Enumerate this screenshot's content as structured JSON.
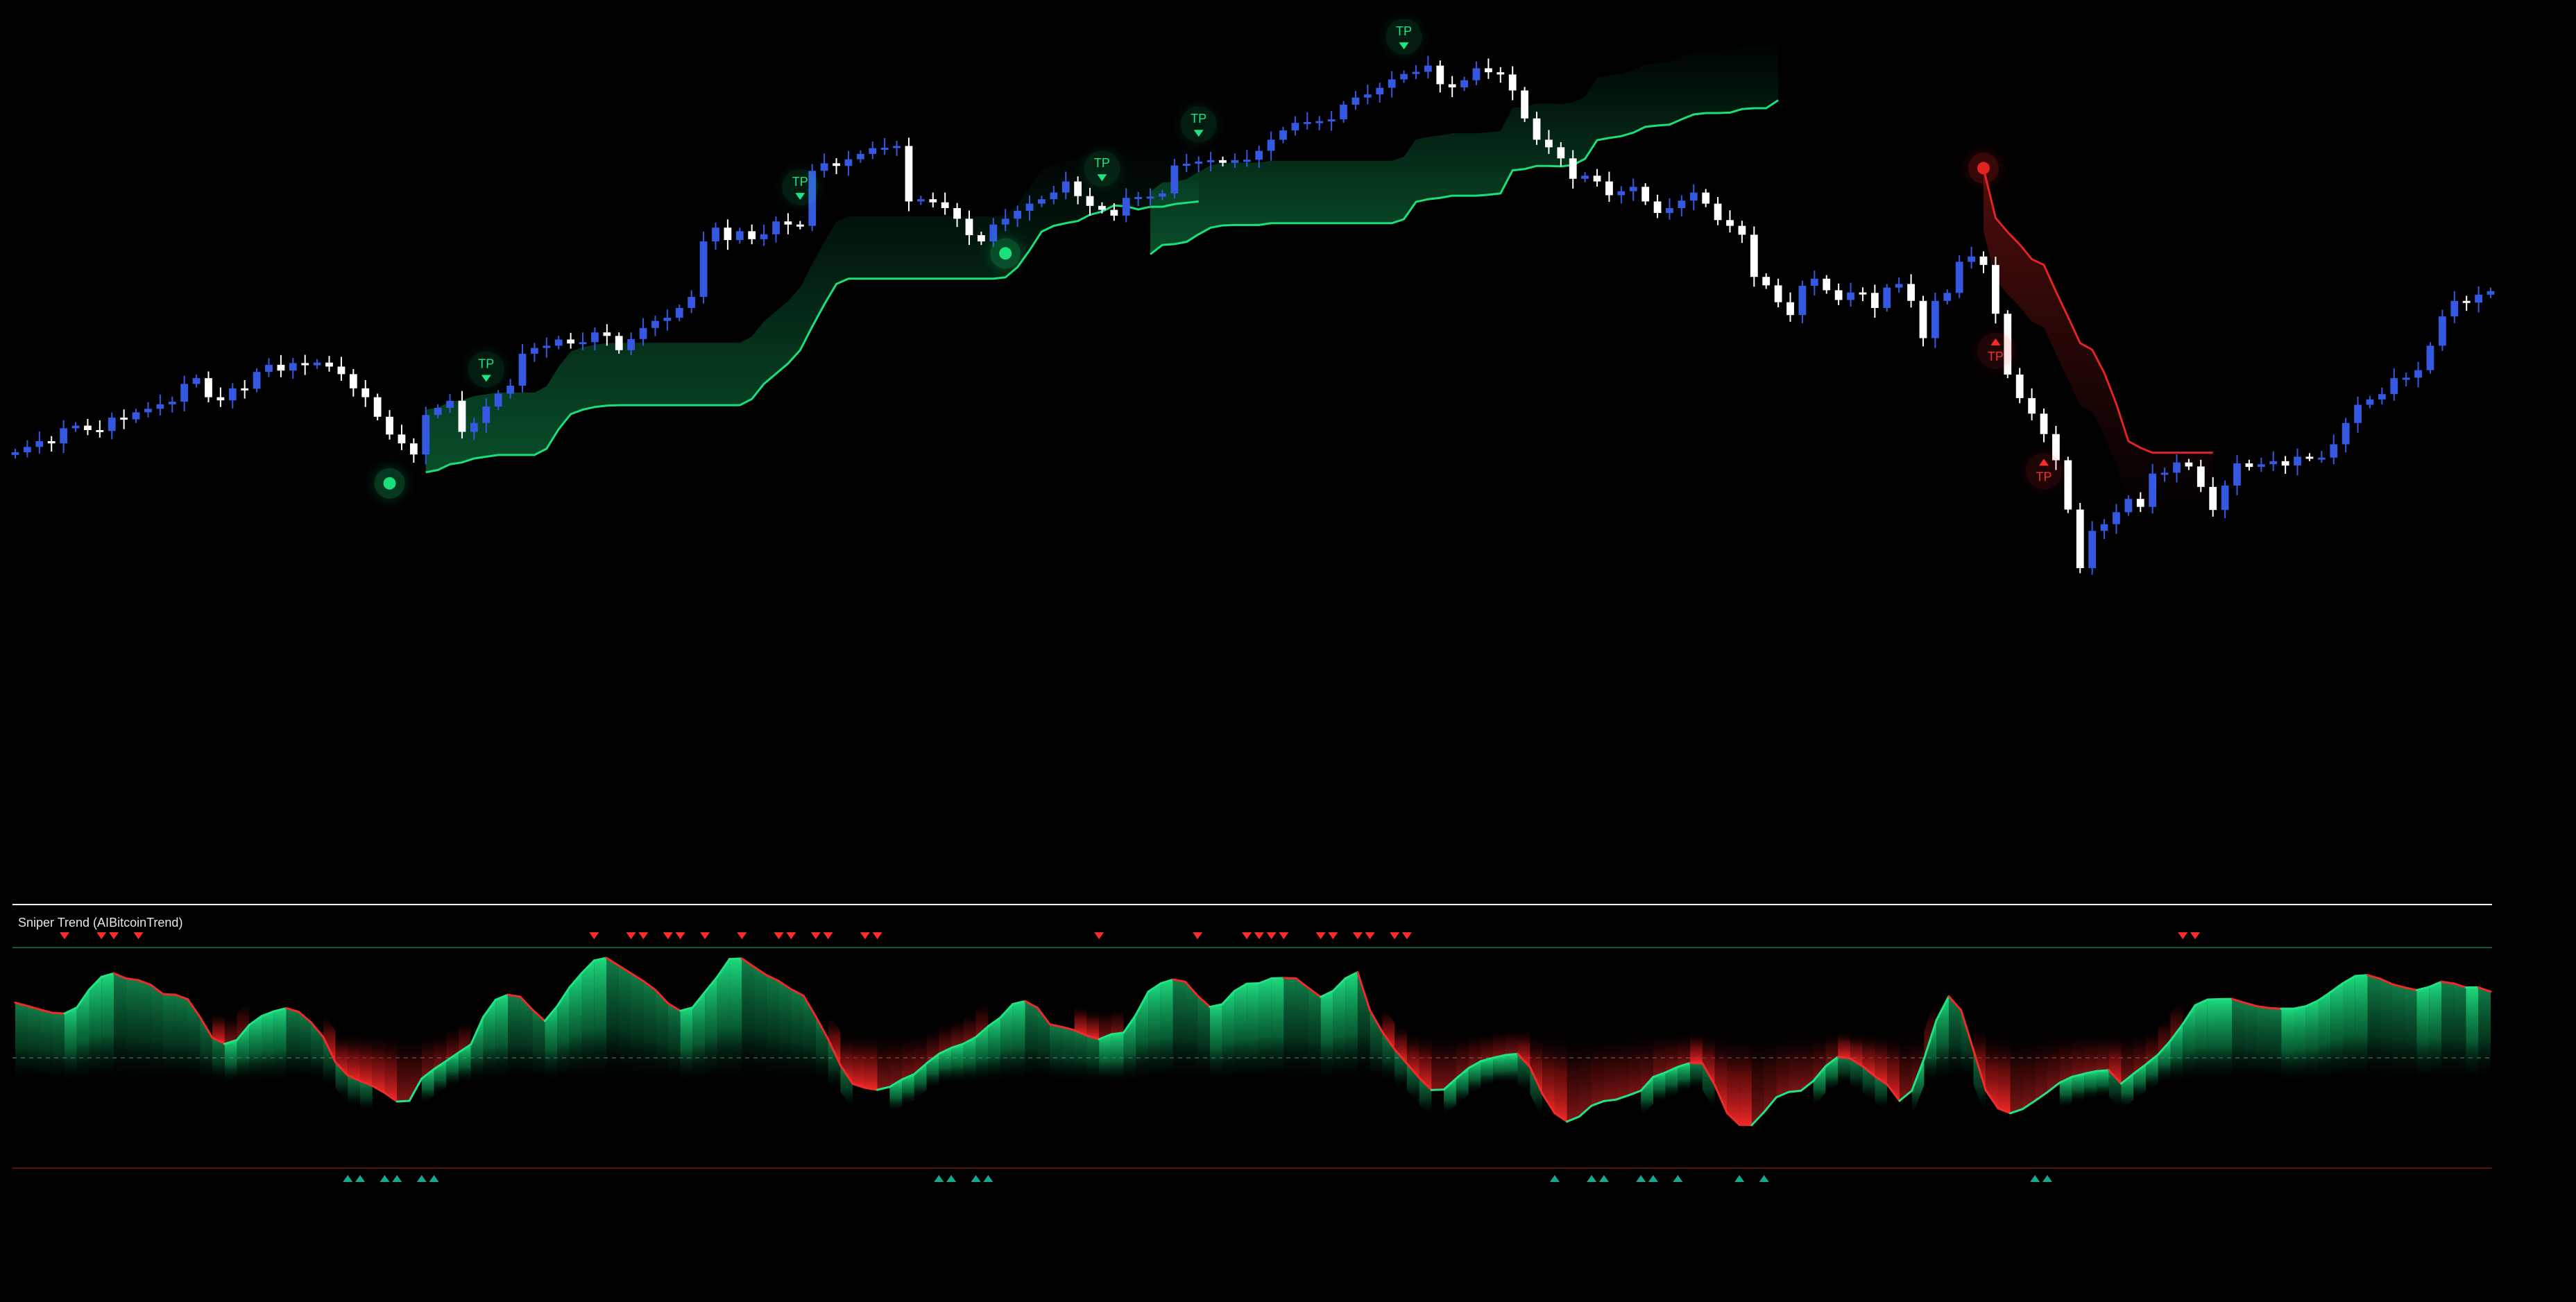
{
  "chart_data": {
    "type": "candlestick",
    "title": "",
    "xlabel": "",
    "ylabel": "",
    "grid": false,
    "colors": {
      "background": "#000000",
      "bull_candle": "#3558e0",
      "bear_candle": "#ffffff",
      "trail_up": "#19e07a",
      "trail_down": "#e02424",
      "osc_bull": "#1ee584",
      "osc_bear": "#ef2a2a",
      "tp_up_label": "#1ee584",
      "tp_down_label": "#ff2a2a",
      "divider": "#ffffff",
      "mid_dashed": "#444444",
      "marker_up": "#17a88f",
      "marker_down": "#ff2a2a"
    },
    "price_pane": {
      "y_range": [
        0,
        100
      ],
      "close": [
        25.0,
        26.2,
        27.5,
        27.0,
        30.4,
        31.0,
        30.0,
        29.8,
        32.8,
        32.4,
        34.0,
        34.8,
        35.8,
        36.4,
        40.4,
        41.7,
        37.4,
        36.7,
        39.4,
        39.3,
        43.1,
        44.7,
        43.4,
        45.1,
        44.6,
        45.2,
        44.3,
        42.6,
        39.4,
        37.4,
        33.0,
        29.0,
        27.0,
        24.5,
        33.4,
        35.0,
        36.6,
        29.6,
        31.6,
        35.3,
        38.2,
        40.0,
        47.2,
        48.5,
        49.0,
        50.4,
        49.5,
        49.8,
        52.0,
        51.2,
        48.0,
        50.5,
        53.0,
        54.6,
        55.3,
        57.5,
        60.0,
        72.5,
        75.6,
        72.8,
        74.8,
        73.0,
        74.1,
        77.0,
        76.3,
        76.0,
        88.4,
        90.1,
        89.5,
        91.0,
        92.2,
        93.5,
        93.6,
        94.0,
        81.5,
        82.0,
        81.3,
        80.0,
        77.6,
        73.9,
        72.5,
        76.3,
        77.6,
        79.4,
        81.0,
        82.0,
        83.5,
        86.0,
        82.7,
        80.5,
        79.6,
        78.3,
        82.3,
        82.5,
        82.6,
        83.3,
        89.6,
        90.0,
        90.5,
        90.8,
        90.2,
        90.8,
        90.9,
        92.9,
        95.4,
        97.5,
        99.2,
        99.4,
        99.6,
        100.0,
        103.3,
        104.9,
        105.6,
        107.1,
        109.0,
        110.2,
        110.7,
        112.1,
        107.9,
        107.2,
        108.8,
        111.5,
        110.6,
        110.1,
        106.5,
        100.2,
        95.4,
        93.7,
        91.2,
        86.6,
        87.3,
        86.0,
        82.9,
        83.8,
        84.8,
        81.5,
        78.9,
        80.0,
        81.7,
        83.5,
        81.0,
        77.3,
        76.0,
        74.0,
        64.5,
        62.6,
        58.8,
        55.9,
        62.5,
        64.1,
        61.5,
        59.3,
        61.0,
        60.9,
        57.5,
        62.1,
        62.9,
        59.1,
        50.7,
        59.1,
        60.9,
        67.9,
        69.1,
        67.2,
        56.2,
        42.5,
        37.2,
        33.7,
        29.1,
        23.2,
        12.1,
        -1.1,
        7.3,
        8.8,
        11.5,
        14.5,
        12.7,
        20.2,
        20.4,
        22.7,
        21.8,
        17.2,
        12.0,
        17.5,
        22.5,
        21.7,
        22.3,
        23.0,
        22.0,
        24.0,
        23.8,
        23.8,
        26.8,
        31.6,
        35.7,
        36.9,
        38.1,
        41.7,
        41.8,
        43.5,
        49.0,
        55.6,
        59.1,
        58.7,
        60.5,
        61.3
      ],
      "trail_up_segments": [
        {
          "start": 34,
          "values": [
            20.5,
            21.0,
            22.3,
            22.7,
            23.6,
            24.0,
            24.4,
            24.4,
            24.4,
            24.4,
            25.8,
            30.2,
            33.6,
            34.6,
            35.2,
            35.5,
            35.6,
            35.6,
            35.6,
            35.6,
            35.6,
            35.6,
            35.6,
            35.6,
            35.6,
            35.6,
            35.6,
            37.0,
            40.4,
            42.7,
            45.0,
            48.0,
            53.3,
            58.3,
            62.9,
            64.1,
            64.1,
            64.1,
            64.1,
            64.1,
            64.1,
            64.1,
            64.1,
            64.1,
            64.1,
            64.1,
            64.1,
            64.1,
            64.4,
            66.7,
            70.5,
            74.7,
            76.0,
            76.6,
            77.1,
            78.5,
            79.2,
            80.6,
            80.4,
            79.7,
            80.3,
            80.3,
            80.9,
            81.2,
            81.5
          ]
        },
        {
          "start": 94,
          "values": [
            69.6,
            71.7,
            71.9,
            72.4,
            74.1,
            75.6,
            76.1,
            76.2,
            76.2,
            76.2,
            76.6,
            76.6,
            76.6,
            76.6,
            76.6,
            76.6,
            76.6,
            76.6,
            76.6,
            76.6,
            76.6,
            77.5,
            81.4,
            82.0,
            82.3,
            82.8,
            82.8,
            82.8,
            83.0,
            83.3,
            88.5,
            88.8,
            89.5,
            89.5,
            89.4,
            89.7,
            91.1,
            95.3,
            95.8,
            96.2,
            97.0,
            98.3,
            98.6,
            98.8,
            100.0,
            101.1,
            101.4,
            101.4,
            101.5,
            102.3,
            102.5,
            102.5,
            104.3
          ]
        }
      ],
      "trail_down_segments": [
        {
          "start": 163,
          "values": [
            89.0,
            77.8,
            74.6,
            71.8,
            68.5,
            67.2,
            61.2,
            55.5,
            49.6,
            48.1,
            42.9,
            35.9,
            27.5,
            26.0,
            24.9,
            24.9,
            24.9,
            24.9,
            24.9,
            24.9
          ]
        }
      ],
      "signals": [
        {
          "index": 31,
          "dir": "up",
          "price": 18.0
        },
        {
          "index": 82,
          "dir": "up",
          "price": 69.8
        },
        {
          "index": 163,
          "dir": "down",
          "price": 89.0
        }
      ],
      "tp_marks": [
        {
          "index": 39,
          "dir": "up",
          "label": "TP"
        },
        {
          "index": 65,
          "dir": "up",
          "label": "TP"
        },
        {
          "index": 90,
          "dir": "up",
          "label": "TP"
        },
        {
          "index": 98,
          "dir": "up",
          "label": "TP"
        },
        {
          "index": 115,
          "dir": "up",
          "label": "TP"
        },
        {
          "index": 164,
          "dir": "down",
          "label": "TP"
        },
        {
          "index": 168,
          "dir": "down",
          "label": "TP"
        }
      ]
    },
    "oscillator_pane": {
      "title": "Sniper Trend (AIBitcoinTrend)",
      "y_range": [
        0,
        100
      ],
      "mid_level": 50,
      "values": [
        75.0,
        73.5,
        71.9,
        70.4,
        70.1,
        72.8,
        80.9,
        86.7,
        88.3,
        86.0,
        85.2,
        83.1,
        78.9,
        78.6,
        76.6,
        68.5,
        59.1,
        56.3,
        58.1,
        64.9,
        68.9,
        71.1,
        72.5,
        70.9,
        66.2,
        59.5,
        48.0,
        42.0,
        39.5,
        37.3,
        34.1,
        30.2,
        30.5,
        40.6,
        44.9,
        48.6,
        52.4,
        56.1,
        68.5,
        76.3,
        78.6,
        77.7,
        71.8,
        66.7,
        73.4,
        81.9,
        88.4,
        94.1,
        95.3,
        91.8,
        88.3,
        84.8,
        80.7,
        74.7,
        71.3,
        72.8,
        79.8,
        86.7,
        94.8,
        95.0,
        91.2,
        87.5,
        84.8,
        81.1,
        78.2,
        68.8,
        58.5,
        46.7,
        38.2,
        36.4,
        35.5,
        36.8,
        40.2,
        42.6,
        47.5,
        51.8,
        54.5,
        56.4,
        59.4,
        64.3,
        68.3,
        74.4,
        75.7,
        72.7,
        65.2,
        64.0,
        62.5,
        60.1,
        58.4,
        60.7,
        61.4,
        69.6,
        80.0,
        83.7,
        85.5,
        84.5,
        78.2,
        73.1,
        74.3,
        80.3,
        83.6,
        83.8,
        86.0,
        86.2,
        86.0,
        81.7,
        77.6,
        80.3,
        86.0,
        88.8,
        71.5,
        61.8,
        53.8,
        47.4,
        40.9,
        35.4,
        35.6,
        40.6,
        45.3,
        48.5,
        50.0,
        51.3,
        51.8,
        45.7,
        33.7,
        24.9,
        21.1,
        23.4,
        28.3,
        30.4,
        31.1,
        33.0,
        35.1,
        41.3,
        43.4,
        45.9,
        47.7,
        47.5,
        37.6,
        25.0,
        19.6,
        19.5,
        25.4,
        32.1,
        34.5,
        35.1,
        39.5,
        46.2,
        50.5,
        49.7,
        46.2,
        41.6,
        37.9,
        30.5,
        35.1,
        49.7,
        67.1,
        77.9,
        71.6,
        53.6,
        35.3,
        27.1,
        24.9,
        26.8,
        30.5,
        34.4,
        38.7,
        41.4,
        42.8,
        44.0,
        44.4,
        38.3,
        42.8,
        47.0,
        51.5,
        57.8,
        65.3,
        73.8,
        76.4,
        76.6,
        76.7,
        75.0,
        73.4,
        72.6,
        72.3,
        72.3,
        73.4,
        76.0,
        79.8,
        83.8,
        87.1,
        87.5,
        85.9,
        83.4,
        81.9,
        80.7,
        82.1,
        84.5,
        83.7,
        81.9,
        81.9,
        80.0
      ],
      "top_markers": [
        4,
        7,
        8,
        10,
        47,
        50,
        51,
        53,
        54,
        56,
        59,
        62,
        63,
        65,
        66,
        69,
        70,
        88,
        96,
        100,
        101,
        102,
        103,
        106,
        107,
        109,
        110,
        112,
        113,
        176,
        177
      ],
      "bottom_markers": [
        27,
        28,
        30,
        31,
        33,
        34,
        75,
        76,
        78,
        79,
        125,
        128,
        129,
        132,
        133,
        135,
        140,
        142,
        164,
        165
      ]
    }
  }
}
